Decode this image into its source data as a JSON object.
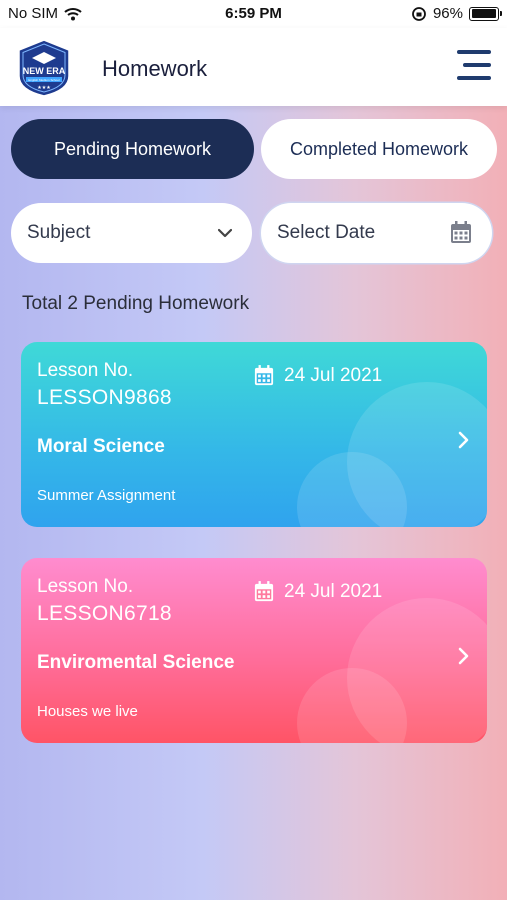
{
  "status_bar": {
    "carrier": "No SIM",
    "time": "6:59 PM",
    "battery_pct": "96%",
    "battery_level": 0.96
  },
  "header": {
    "title": "Homework",
    "logo_text": "NEW ERA",
    "logo_subtext": "English Medium School"
  },
  "tabs": [
    {
      "label": "Pending Homework",
      "active": true
    },
    {
      "label": "Completed Homework",
      "active": false
    }
  ],
  "filters": {
    "subject_label": "Subject",
    "date_label": "Select Date"
  },
  "summary": "Total 2 Pending Homework",
  "homework": [
    {
      "lesson_label": "Lesson No.",
      "lesson_no": "LESSON9868",
      "date": "24 Jul 2021",
      "subject": "Moral Science",
      "description": "Summer Assignment"
    },
    {
      "lesson_label": "Lesson No.",
      "lesson_no": "LESSON6718",
      "date": "24 Jul 2021",
      "subject": "Enviromental Science",
      "description": "Houses we live"
    }
  ],
  "colors": {
    "primary": "#1c2d55",
    "card1": "#34b7e8",
    "card2": "#ff6d9a"
  }
}
